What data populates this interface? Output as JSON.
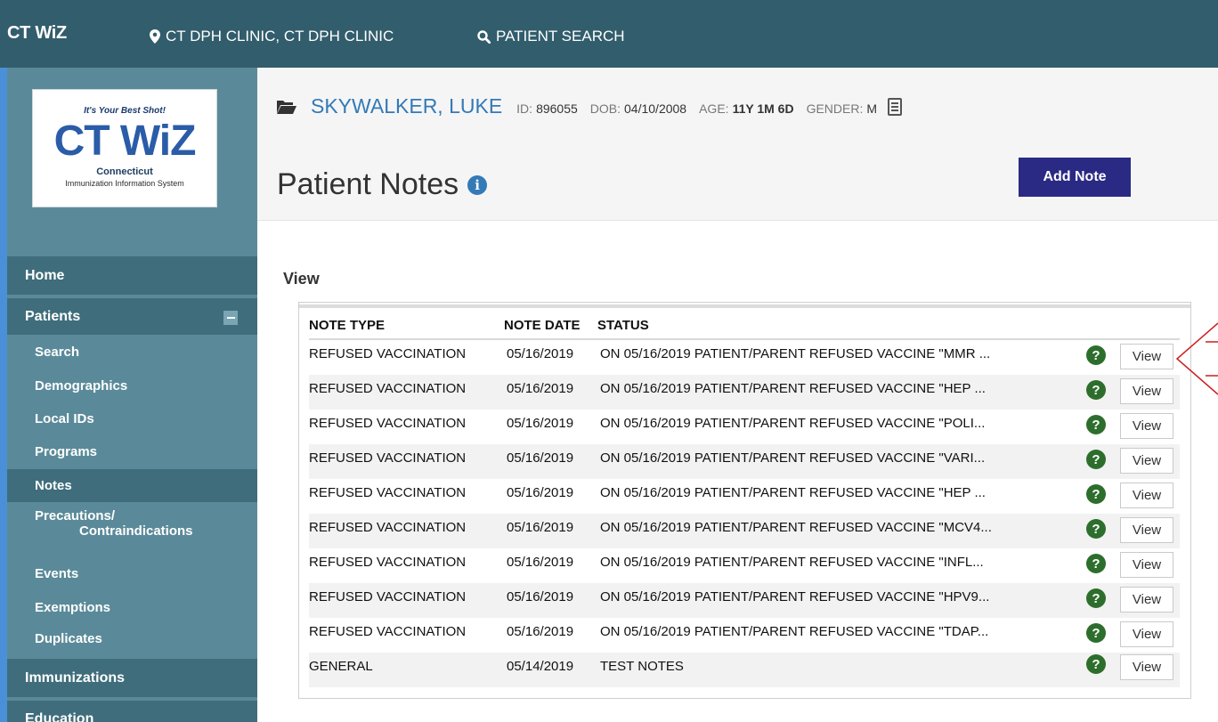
{
  "topbar": {
    "brand": "CT WiZ",
    "clinic": "CT DPH CLINIC, CT DPH CLINIC",
    "patient_search": "PATIENT SEARCH"
  },
  "logo": {
    "tagline": "It's Your Best Shot!",
    "mark": "CT WiZ",
    "state": "Connecticut",
    "system": "Immunization Information System"
  },
  "sidebar": {
    "main_items": [
      "Home",
      "Patients",
      "Immunizations",
      "Education"
    ],
    "patient_sub_items": [
      "Search",
      "Demographics",
      "Local IDs",
      "Programs",
      "Notes"
    ],
    "precautions_line1": "Precautions/",
    "precautions_line2": "Contraindications",
    "patient_sub_items_2": [
      "Events",
      "Exemptions",
      "Duplicates"
    ],
    "active_item": "Notes"
  },
  "patient": {
    "name": "SKYWALKER, LUKE",
    "id_label": "ID:",
    "id": "896055",
    "dob_label": "DOB:",
    "dob": "04/10/2008",
    "age_label": "AGE:",
    "age": "11Y 1M 6D",
    "gender_label": "GENDER:",
    "gender": "M"
  },
  "page": {
    "title": "Patient Notes",
    "add_note_label": "Add Note",
    "section_title": "View"
  },
  "table": {
    "headers": [
      "NOTE TYPE",
      "NOTE DATE",
      "STATUS"
    ],
    "view_label": "View",
    "rows": [
      {
        "type": "REFUSED VACCINATION",
        "date": "05/16/2019",
        "status": "ON 05/16/2019 PATIENT/PARENT REFUSED VACCINE \"MMR ..."
      },
      {
        "type": "REFUSED VACCINATION",
        "date": "05/16/2019",
        "status": "ON 05/16/2019 PATIENT/PARENT REFUSED VACCINE \"HEP ..."
      },
      {
        "type": "REFUSED VACCINATION",
        "date": "05/16/2019",
        "status": "ON 05/16/2019 PATIENT/PARENT REFUSED VACCINE \"POLI..."
      },
      {
        "type": "REFUSED VACCINATION",
        "date": "05/16/2019",
        "status": "ON 05/16/2019 PATIENT/PARENT REFUSED VACCINE \"VARI..."
      },
      {
        "type": "REFUSED VACCINATION",
        "date": "05/16/2019",
        "status": "ON 05/16/2019 PATIENT/PARENT REFUSED VACCINE \"HEP ..."
      },
      {
        "type": "REFUSED VACCINATION",
        "date": "05/16/2019",
        "status": "ON 05/16/2019 PATIENT/PARENT REFUSED VACCINE \"MCV4..."
      },
      {
        "type": "REFUSED VACCINATION",
        "date": "05/16/2019",
        "status": "ON 05/16/2019 PATIENT/PARENT REFUSED VACCINE \"INFL..."
      },
      {
        "type": "REFUSED VACCINATION",
        "date": "05/16/2019",
        "status": "ON 05/16/2019 PATIENT/PARENT REFUSED VACCINE \"HPV9..."
      },
      {
        "type": "REFUSED VACCINATION",
        "date": "05/16/2019",
        "status": "ON 05/16/2019 PATIENT/PARENT REFUSED VACCINE \"TDAP..."
      },
      {
        "type": "GENERAL",
        "date": "05/14/2019",
        "status": "TEST NOTES"
      }
    ]
  },
  "colors": {
    "topbar": "#325d6c",
    "sidebar": "#5a8a99",
    "sidebar_active": "#3f6d7c",
    "accent_button": "#2a2a84",
    "link": "#337ab7",
    "help_icon": "#2d6e2d",
    "annotation_arrow": "#cc1f1f"
  },
  "icons": {
    "clinic": "map-marker-icon",
    "search": "search-icon",
    "folder": "folder-open-icon",
    "document": "document-icon",
    "info": "info-circle-icon",
    "help": "question-circle-icon",
    "collapse": "minus-square-icon"
  }
}
